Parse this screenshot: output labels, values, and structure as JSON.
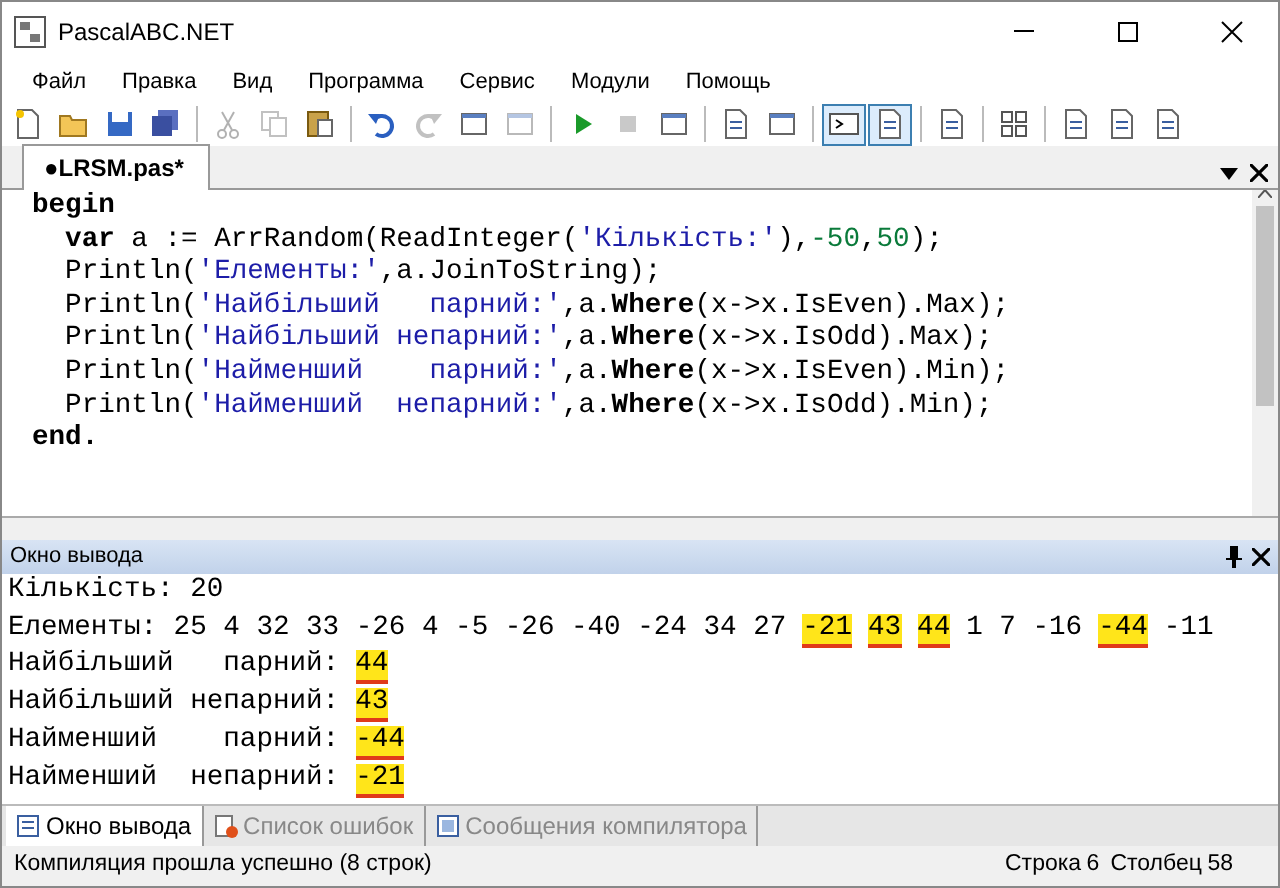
{
  "window": {
    "title": "PascalABC.NET"
  },
  "menu": [
    "Файл",
    "Правка",
    "Вид",
    "Программа",
    "Сервис",
    "Модули",
    "Помощь"
  ],
  "toolbar": [
    {
      "kind": "new",
      "disabled": false,
      "pressed": false
    },
    {
      "kind": "open",
      "disabled": false,
      "pressed": false
    },
    {
      "kind": "save",
      "disabled": false,
      "pressed": false
    },
    {
      "kind": "save-all",
      "disabled": false,
      "pressed": false
    },
    {
      "kind": "separator"
    },
    {
      "kind": "cut",
      "disabled": true,
      "pressed": false
    },
    {
      "kind": "copy",
      "disabled": true,
      "pressed": false
    },
    {
      "kind": "paste",
      "disabled": false,
      "pressed": false
    },
    {
      "kind": "separator"
    },
    {
      "kind": "undo",
      "disabled": false,
      "pressed": false
    },
    {
      "kind": "redo",
      "disabled": true,
      "pressed": false
    },
    {
      "kind": "window",
      "disabled": false,
      "pressed": false
    },
    {
      "kind": "window",
      "disabled": true,
      "pressed": false
    },
    {
      "kind": "separator"
    },
    {
      "kind": "run",
      "disabled": false,
      "pressed": false
    },
    {
      "kind": "stop",
      "disabled": true,
      "pressed": false
    },
    {
      "kind": "window",
      "disabled": false,
      "pressed": false
    },
    {
      "kind": "separator"
    },
    {
      "kind": "document",
      "disabled": false,
      "pressed": false
    },
    {
      "kind": "window",
      "disabled": false,
      "pressed": false
    },
    {
      "kind": "separator"
    },
    {
      "kind": "console",
      "disabled": false,
      "pressed": true
    },
    {
      "kind": "document",
      "disabled": false,
      "pressed": true
    },
    {
      "kind": "separator"
    },
    {
      "kind": "document",
      "disabled": false,
      "pressed": false
    },
    {
      "kind": "separator"
    },
    {
      "kind": "grid",
      "disabled": false,
      "pressed": false
    },
    {
      "kind": "separator"
    },
    {
      "kind": "document",
      "disabled": false,
      "pressed": false
    },
    {
      "kind": "document",
      "disabled": false,
      "pressed": false
    },
    {
      "kind": "document",
      "disabled": false,
      "pressed": false
    }
  ],
  "editor_tabs": [
    {
      "label": "●LRSM.pas*",
      "selected": true
    }
  ],
  "code": [
    [
      {
        "kind": "keyword",
        "text": "begin"
      }
    ],
    [
      {
        "kind": "keyword",
        "text": "  var"
      },
      {
        "kind": "plain",
        "text": " a := ArrRandom(ReadInteger("
      },
      {
        "kind": "string",
        "text": "'Кількість:'"
      },
      {
        "kind": "plain",
        "text": "),"
      },
      {
        "kind": "number",
        "text": "-50"
      },
      {
        "kind": "plain",
        "text": ","
      },
      {
        "kind": "number",
        "text": "50"
      },
      {
        "kind": "plain",
        "text": ");"
      }
    ],
    [
      {
        "kind": "plain",
        "text": "  Println("
      },
      {
        "kind": "string",
        "text": "'Елементы:'"
      },
      {
        "kind": "plain",
        "text": ",a.JoinToString);"
      }
    ],
    [
      {
        "kind": "plain",
        "text": "  Println("
      },
      {
        "kind": "string",
        "text": "'Найбільший   парний:'"
      },
      {
        "kind": "plain",
        "text": ",a."
      },
      {
        "kind": "keyword",
        "text": "Where"
      },
      {
        "kind": "plain",
        "text": "(x->x.IsEven).Max);"
      }
    ],
    [
      {
        "kind": "plain",
        "text": "  Println("
      },
      {
        "kind": "string",
        "text": "'Найбільший непарний:'"
      },
      {
        "kind": "plain",
        "text": ",a."
      },
      {
        "kind": "keyword",
        "text": "Where"
      },
      {
        "kind": "plain",
        "text": "(x->x.IsOdd).Max);"
      }
    ],
    [
      {
        "kind": "plain",
        "text": "  Println("
      },
      {
        "kind": "string",
        "text": "'Найменший    парний:'"
      },
      {
        "kind": "plain",
        "text": ",a."
      },
      {
        "kind": "keyword",
        "text": "Where"
      },
      {
        "kind": "plain",
        "text": "(x->x.IsEven).Min);"
      }
    ],
    [
      {
        "kind": "plain",
        "text": "  Println("
      },
      {
        "kind": "string",
        "text": "'Найменший  непарний:'"
      },
      {
        "kind": "plain",
        "text": ",a."
      },
      {
        "kind": "keyword",
        "text": "Where"
      },
      {
        "kind": "plain",
        "text": "(x->x.IsOdd).Min);"
      }
    ],
    [
      {
        "kind": "keyword",
        "text": "end."
      }
    ]
  ],
  "output_panel": {
    "title": "Окно вывода",
    "lines": [
      [
        {
          "text": "Кількість: 20",
          "highlighted": false
        }
      ],
      [
        {
          "text": "Елементы: 25 4 32 33 -26 4 -5 -26 -40 -24 34 27",
          "highlighted": false
        },
        {
          "text": "-21",
          "highlighted": true
        },
        {
          "text": "43",
          "highlighted": true
        },
        {
          "text": "44",
          "highlighted": true
        },
        {
          "text": "1 7 -16",
          "highlighted": false
        },
        {
          "text": "-44",
          "highlighted": true
        },
        {
          "text": "-11",
          "highlighted": false
        }
      ],
      [
        {
          "text": "Найбільший   парний:",
          "highlighted": false
        },
        {
          "text": "44",
          "highlighted": true
        }
      ],
      [
        {
          "text": "Найбільший непарний:",
          "highlighted": false
        },
        {
          "text": "43",
          "highlighted": true
        }
      ],
      [
        {
          "text": "Найменший    парний:",
          "highlighted": false
        },
        {
          "text": "-44",
          "highlighted": true
        }
      ],
      [
        {
          "text": "Найменший  непарний:",
          "highlighted": false
        },
        {
          "text": "-21",
          "highlighted": true
        }
      ]
    ]
  },
  "bottom_tabs": [
    {
      "label": "Окно вывода",
      "selected": true
    },
    {
      "label": "Список ошибок",
      "selected": false
    },
    {
      "label": "Сообщения компилятора",
      "selected": false
    }
  ],
  "status_bar": {
    "message": "Компиляция прошла успешно (8 строк)",
    "line_label": "Строка",
    "line": "6",
    "column_label": "Столбец",
    "column": "58"
  }
}
